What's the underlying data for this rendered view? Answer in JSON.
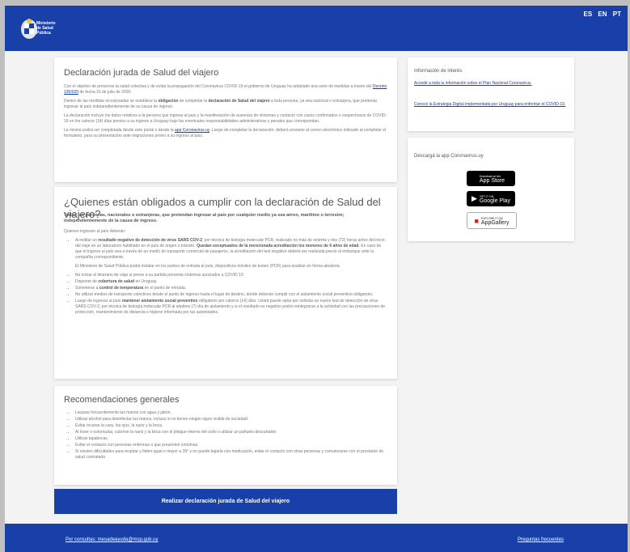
{
  "header": {
    "logo_lines": [
      "Ministerio",
      "de Salud",
      "Pública"
    ],
    "languages": [
      "ES",
      "EN",
      "PT"
    ]
  },
  "card1": {
    "title": "Declaración jurada de Salud del viajero",
    "p1_a": "Con el objetivo de preservar la salud colectiva y de evitar la propagación del Coronavirus COVID-19 el gobierno de Uruguay ha adoptado una serie de medidas a través del ",
    "p1_link": "Decreto 195/020",
    "p1_b": " de fecha 15 de julio de 2020.",
    "p2_a": "Dentro de las medidas incorporadas se establece la ",
    "p2_bold1": "obligación",
    "p2_b": " de completar la ",
    "p2_bold2": "declaración de Salud del viajero",
    "p2_c": " a toda persona, ya sea nacional o extranjera, que pretenda ingresar al país independientemente de su causa de ingreso.",
    "p3": "La declaración incluye los datos relativos a la persona que ingresa al país y la manifestación de ausencia de síntomas y contacto con casos confirmados o sospechosos de COVID-19 en los catorce (14) días previos a su ingreso a Uruguay bajo las eventuales responsabilidades administrativas y penales que correspondan.",
    "p4_a": "La misma podrá ser completada desde este portal o desde la ",
    "p4_link": "app Coronavirus.uy",
    "p4_b": ". Luego de completar la declaración, deberá enviarse al correo electrónico indicado al completar el formulario, para su presentación ante migraciones previo a su ingreso al país."
  },
  "card2": {
    "title": "¿Quienes están obligados a cumplir con la declaración de Salud del viajero?",
    "intro": "Todas las personas, nacionales o extranjeras, que pretendan ingresar al país por cualquier medio ya sea aéreo, marítimo o terrestre; independientemente de la causa de ingreso.",
    "lead": "Quienes ingresen al país deberán:",
    "item1_a": "Acreditar un ",
    "item1_bold": "resultado negativo de detección de virus SARS COV-2",
    "item1_b": ", por técnica de biología molecular PCR, realizado no más de setenta y dos (72) horas antes del inicio del viaje en un laboratorio habilitado en el país de origen o tránsito. ",
    "item1_bold2": "Quedan exceptuados de la mencionada acreditación los menores de 6 años de edad",
    "item1_c": ". En caso de que el ingreso al país sea a través de un medio de transporte comercial de pasajeros, la acreditación del test negativo deberá ser realizada previo al embarque ante la compañía correspondiente.",
    "item1_note": "El Ministerio de Salud Pública podrá instalar en los puntos de entrada al país, dispositivos móviles de testeo (PCR) para analizar en forma aleatoria.",
    "item2": "No iniciar el itinerario de viaje si previo a su partida presenta síntomas asociados a COVID 19",
    "item3_a": "Disponer de ",
    "item3_bold": "cobertura de salud",
    "item3_b": " en Uruguay.",
    "item4_a": "Someterse a ",
    "item4_bold": "control de temperatura",
    "item4_b": " en el punto de entrada.",
    "item5": "No utilizar medios de transporte colectivos desde el punto de ingreso hasta el lugar de destino, donde deberán cumplir con el aislamiento social preventivo obligatorio.",
    "item6_a": "Luego de ingresar al país ",
    "item6_bold": "mantener aislamiento social preventivo",
    "item6_b": " obligatorio por catorce (14) días. Usted puede optar por solicitar un nuevo test de detección de virus SARS COV-2, por técnica de biología molecular PCR al séptimo (7) día de aislamiento y si el resultado es negativo podrá reintegrarse a la actividad con las precauciones de protección, mantenimiento de distancia e higiene informada por las autoridades."
  },
  "card3": {
    "title": "Recomendaciones generales",
    "items": [
      "Lavarse frecuentemente las manos con agua y jabón.",
      "Utilizar alcohol para desinfectar tus manos, incluso si no tienen ningún signo visible de suciedad.",
      "Evitar tocarse la cara, los ojos, la nariz y la boca.",
      "Al toser o estornudar, cubrirse la nariz y la boca con el pliegue interno del codo o utilizar un pañuelo descartable.",
      "Utilizar tapabocas.",
      "Evitar el contacto con personas enfermas o que presenten síntomas.",
      "Si existen dificultades para respirar y fiebre igual o mayor a 39° y no puede bajarla con medicación, evitar el contacto con otras personas y comunicarse con el prestador de salud contratado."
    ]
  },
  "sidebar": {
    "info_title": "Información de interés",
    "link1": "Accedé a toda la información sobre el Plan Nacional Coronavirus.",
    "link2": "Conocé la Estrategia Digital implementada por Uruguay para enfrentar el COVID-19.",
    "app_title": "Descargá la app Coronavirus.uy",
    "appstore_small": "Download on the",
    "appstore_big": "App Store",
    "gplay_small": "GET IT ON",
    "gplay_big": "Google Play",
    "ag_small": "EXPLORE IT ON",
    "ag_big": "AppGallery"
  },
  "cta": {
    "label": "Realizar declaración jurada de Salud del viajero"
  },
  "footer": {
    "contact": "Por consultas: mesadeayuda@msp.gub.uy",
    "faq": "Preguntas frecuentes"
  },
  "colors": {
    "brand_blue": "#1840a8",
    "background": "#f3f3f3"
  }
}
